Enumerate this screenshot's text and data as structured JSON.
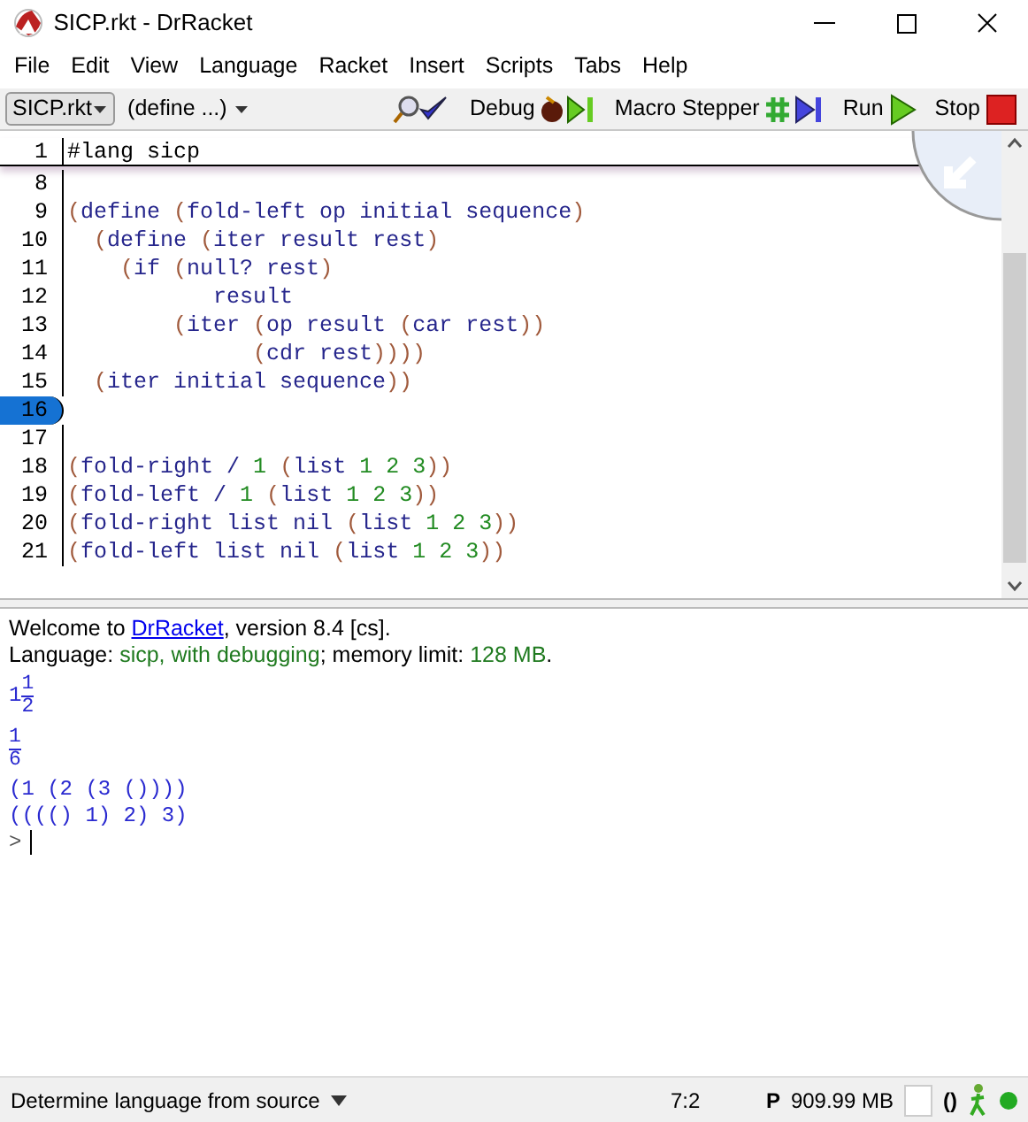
{
  "window": {
    "title": "SICP.rkt - DrRacket"
  },
  "menu": [
    "File",
    "Edit",
    "View",
    "Language",
    "Racket",
    "Insert",
    "Scripts",
    "Tabs",
    "Help"
  ],
  "toolbar": {
    "file_button": "SICP.rkt",
    "define_menu": "(define ...)",
    "buttons": [
      {
        "kind": "check"
      },
      {
        "kind": "debug",
        "label": "Debug"
      },
      {
        "kind": "macro",
        "label": "Macro Stepper"
      },
      {
        "kind": "run",
        "label": "Run"
      },
      {
        "kind": "stop",
        "label": "Stop"
      }
    ]
  },
  "editor": {
    "header": {
      "number": "1",
      "tokens": [
        {
          "kind": "plain",
          "text": "#lang sicp"
        }
      ]
    },
    "lines": [
      {
        "number": "8",
        "selected": false
      },
      {
        "number": "9",
        "selected": false,
        "tokens": [
          {
            "kind": "paren",
            "text": "("
          },
          {
            "kind": "symbol",
            "text": "define "
          },
          {
            "kind": "paren",
            "text": "("
          },
          {
            "kind": "symbol",
            "text": "fold-left op initial sequence"
          },
          {
            "kind": "paren",
            "text": ")"
          }
        ]
      },
      {
        "number": "10",
        "selected": false,
        "tokens": [
          {
            "kind": "paren",
            "text": "  ("
          },
          {
            "kind": "symbol",
            "text": "define "
          },
          {
            "kind": "paren",
            "text": "("
          },
          {
            "kind": "symbol",
            "text": "iter result rest"
          },
          {
            "kind": "paren",
            "text": ")"
          }
        ]
      },
      {
        "number": "11",
        "selected": false,
        "tokens": [
          {
            "kind": "paren",
            "text": "    ("
          },
          {
            "kind": "symbol",
            "text": "if "
          },
          {
            "kind": "paren",
            "text": "("
          },
          {
            "kind": "symbol",
            "text": "null? rest"
          },
          {
            "kind": "paren",
            "text": ")"
          }
        ]
      },
      {
        "number": "12",
        "selected": false,
        "tokens": [
          {
            "kind": "symbol",
            "text": "           result"
          }
        ]
      },
      {
        "number": "13",
        "selected": false,
        "tokens": [
          {
            "kind": "paren",
            "text": "        ("
          },
          {
            "kind": "symbol",
            "text": "iter "
          },
          {
            "kind": "paren",
            "text": "("
          },
          {
            "kind": "symbol",
            "text": "op result "
          },
          {
            "kind": "paren",
            "text": "("
          },
          {
            "kind": "symbol",
            "text": "car rest"
          },
          {
            "kind": "paren",
            "text": "))"
          }
        ]
      },
      {
        "number": "14",
        "selected": false,
        "tokens": [
          {
            "kind": "paren",
            "text": "              ("
          },
          {
            "kind": "symbol",
            "text": "cdr rest"
          },
          {
            "kind": "paren",
            "text": "))))"
          }
        ]
      },
      {
        "number": "15",
        "selected": false,
        "tokens": [
          {
            "kind": "paren",
            "text": "  ("
          },
          {
            "kind": "symbol",
            "text": "iter initial sequence"
          },
          {
            "kind": "paren",
            "text": "))"
          }
        ]
      },
      {
        "number": "16",
        "selected": true
      },
      {
        "number": "17",
        "selected": false
      },
      {
        "number": "18",
        "selected": false,
        "tokens": [
          {
            "kind": "paren",
            "text": "("
          },
          {
            "kind": "symbol",
            "text": "fold-right / "
          },
          {
            "kind": "number",
            "text": "1 "
          },
          {
            "kind": "paren",
            "text": "("
          },
          {
            "kind": "symbol",
            "text": "list "
          },
          {
            "kind": "number",
            "text": "1 2 3"
          },
          {
            "kind": "paren",
            "text": "))"
          }
        ]
      },
      {
        "number": "19",
        "selected": false,
        "tokens": [
          {
            "kind": "paren",
            "text": "("
          },
          {
            "kind": "symbol",
            "text": "fold-left / "
          },
          {
            "kind": "number",
            "text": "1 "
          },
          {
            "kind": "paren",
            "text": "("
          },
          {
            "kind": "symbol",
            "text": "list "
          },
          {
            "kind": "number",
            "text": "1 2 3"
          },
          {
            "kind": "paren",
            "text": "))"
          }
        ]
      },
      {
        "number": "20",
        "selected": false,
        "tokens": [
          {
            "kind": "paren",
            "text": "("
          },
          {
            "kind": "symbol",
            "text": "fold-right list nil "
          },
          {
            "kind": "paren",
            "text": "("
          },
          {
            "kind": "symbol",
            "text": "list "
          },
          {
            "kind": "number",
            "text": "1 2 3"
          },
          {
            "kind": "paren",
            "text": "))"
          }
        ]
      },
      {
        "number": "21",
        "selected": false,
        "tokens": [
          {
            "kind": "paren",
            "text": "("
          },
          {
            "kind": "symbol",
            "text": "fold-left list nil "
          },
          {
            "kind": "paren",
            "text": "("
          },
          {
            "kind": "symbol",
            "text": "list "
          },
          {
            "kind": "number",
            "text": "1 2 3"
          },
          {
            "kind": "paren",
            "text": "))"
          }
        ]
      }
    ]
  },
  "repl": {
    "welcome": [
      {
        "kind": "plain",
        "text": "Welcome to "
      },
      {
        "kind": "link",
        "text": "DrRacket"
      },
      {
        "kind": "plain",
        "text": ", version 8.4 [cs]."
      }
    ],
    "language": [
      {
        "kind": "plain",
        "text": "Language: "
      },
      {
        "kind": "green",
        "text": "sicp, with debugging"
      },
      {
        "kind": "plain",
        "text": "; memory limit: "
      },
      {
        "kind": "green",
        "text": "128 MB"
      },
      {
        "kind": "plain",
        "text": "."
      }
    ],
    "results": [
      {
        "kind": "mixed",
        "whole": "1",
        "numerator": "1",
        "denominator": "2"
      },
      {
        "kind": "fraction",
        "numerator": "1",
        "denominator": "6"
      },
      {
        "kind": "text",
        "text": "(1 (2 (3 ())))"
      },
      {
        "kind": "text",
        "text": "(((() 1) 2) 3)"
      }
    ],
    "prompt": ">"
  },
  "status_bar": {
    "language": "Determine language from source",
    "position": "7:2",
    "mode": "P",
    "memory": "909.99 MB",
    "paren_indicator": "()"
  }
}
